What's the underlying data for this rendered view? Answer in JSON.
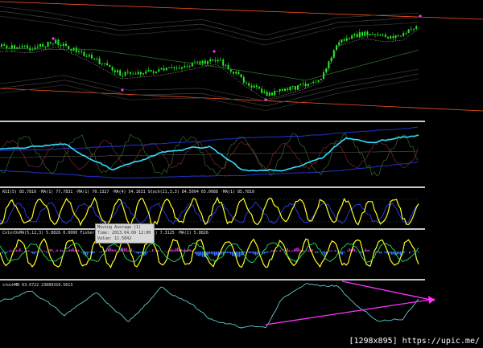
{
  "indicators": {
    "rsi_label": "RSI(5) 85.7810 ·MA(1) 77.7831 ·MA(1) 70.1327 ·MA(4) 54.1631  Stoch(21,3,3) 84.5094 65.0088 ·MA(1) 85.7810",
    "color_label": "ColorOsMA(5,12,3) 5.8826 0.0000  Fisher_Yur4ik 0.172  OsMA(5,12,1) 7.3125 ·MA(1) 5.8826",
    "stoch_label": "stochMB 63.6722 23889310.5613"
  },
  "tooltip": {
    "line1": "Moving Average (1)",
    "line2": "Time: 2013.04.09 12:00",
    "line3": "Value: 11.5842"
  },
  "watermark": "[1298x895] https://upic.me/",
  "colors": {
    "candle_up": "#22ee22",
    "trend_line": "#ff5522",
    "arrow": "#ff33ff",
    "rsi_line": "#ffff22",
    "cyan": "#33ddff",
    "osma_bar": "#3377ff",
    "osma_bar_pos": "#bb33bb",
    "separator": "#c8c8c8"
  }
}
